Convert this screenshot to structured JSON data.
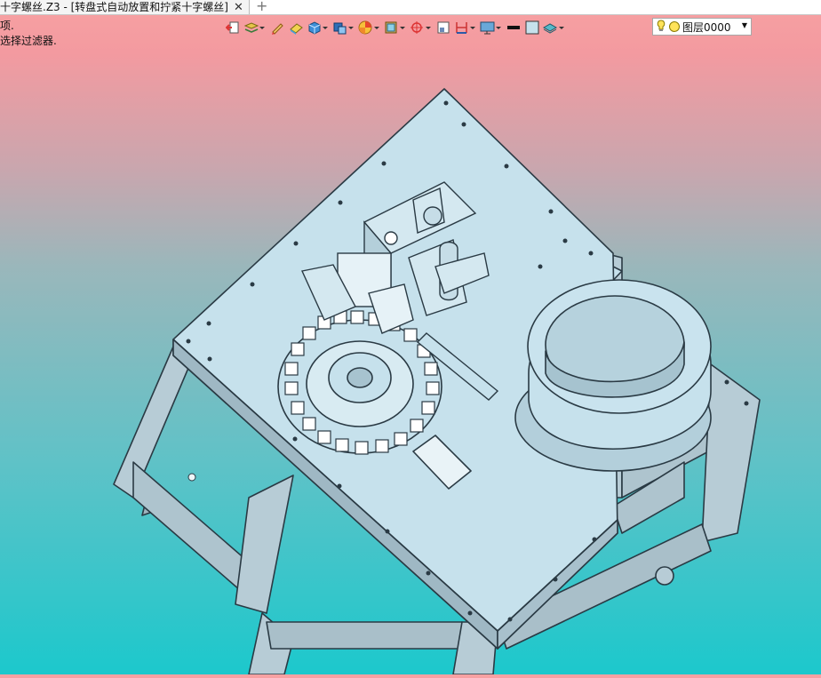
{
  "window": {
    "tab_title": "十字螺丝.Z3 - [转盘式自动放置和拧紧十字螺丝]",
    "close_glyph": "✕",
    "new_tab_glyph": "+"
  },
  "prompt": {
    "line1": "项.",
    "line2": "选择过滤器."
  },
  "toolbar": {
    "icons": [
      "exit-sketch-icon",
      "layers-icon",
      "pencil-icon",
      "eraser-icon",
      "solid-box-icon",
      "shaded-box-icon",
      "color-wheel-icon",
      "render-mode-icon",
      "snap-icon",
      "frame-icon",
      "dimension-icon",
      "display-icon",
      "line-style-icon",
      "fill-color-icon",
      "layer-icon"
    ]
  },
  "layer": {
    "value": "图层0000",
    "bulb_icon": "lightbulb-icon"
  },
  "colors": {
    "background_top": "#f7a1a2",
    "background_bottom": "#1cc8cc",
    "model_plate": "#c6e1ec",
    "model_edge": "#2a3a44",
    "model_frame": "#b7ccd6"
  }
}
